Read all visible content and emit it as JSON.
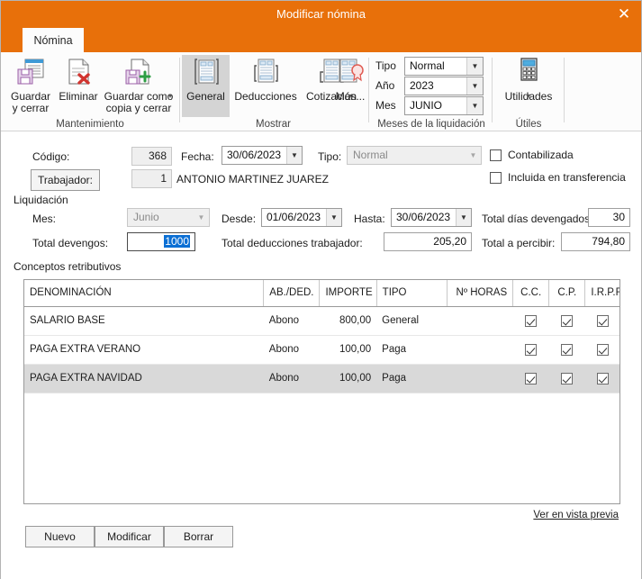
{
  "window": {
    "title": "Modificar nómina",
    "close_label": "✕",
    "accent_color": "#E8700A"
  },
  "ribbon": {
    "tab_label": "Nómina",
    "groups": [
      {
        "name": "Mantenimiento",
        "label": "Mantenimiento",
        "buttons": [
          {
            "name": "guardar-y-cerrar",
            "label": "Guardar\ny cerrar",
            "icon": "save-close-icon"
          },
          {
            "name": "eliminar",
            "label": "Eliminar",
            "icon": "delete-document-icon"
          },
          {
            "name": "guardar-como-copia-y-cerrar",
            "label": "Guardar como\ncopia y cerrar",
            "icon": "save-copy-icon",
            "has_dropdown": true
          }
        ]
      },
      {
        "name": "Mostrar",
        "label": "Mostrar",
        "buttons": [
          {
            "name": "general",
            "label": "General",
            "icon": "document-general-icon",
            "selected": true
          },
          {
            "name": "deducciones",
            "label": "Deducciones",
            "icon": "document-deductions-icon"
          },
          {
            "name": "cotizacion",
            "label": "Cotización",
            "icon": "document-contribution-icon"
          },
          {
            "name": "mas",
            "label": "Más...",
            "icon": "document-seal-icon",
            "has_dropdown": true
          }
        ]
      },
      {
        "name": "Meses de la liquidación",
        "label": "Meses de la liquidación",
        "fields": [
          {
            "name": "tipo",
            "label": "Tipo",
            "value": "Normal"
          },
          {
            "name": "ano",
            "label": "Año",
            "value": "2023"
          },
          {
            "name": "mes",
            "label": "Mes",
            "value": "JUNIO"
          }
        ]
      },
      {
        "name": "Útiles",
        "label": "Útiles",
        "buttons": [
          {
            "name": "utilidades",
            "label": "Utilidades",
            "icon": "calculator-icon",
            "has_dropdown": true
          }
        ]
      }
    ]
  },
  "form": {
    "codigo_label": "Código:",
    "codigo_value": "368",
    "fecha_label": "Fecha:",
    "fecha_value": "30/06/2023",
    "tipo_label": "Tipo:",
    "tipo_value": "Normal",
    "trabajador_button": "Trabajador:",
    "trabajador_code": "1",
    "trabajador_name": "ANTONIO MARTINEZ JUAREZ",
    "contabilizada_label": "Contabilizada",
    "incluida_label": "Incluida en transferencia",
    "liquidacion_label": "Liquidación",
    "mes_label": "Mes:",
    "mes_value": "Junio",
    "desde_label": "Desde:",
    "desde_value": "01/06/2023",
    "hasta_label": "Hasta:",
    "hasta_value": "30/06/2023",
    "total_dias_label": "Total días devengados:",
    "total_dias_value": "30",
    "total_devengos_label": "Total devengos:",
    "total_devengos_value": "1000",
    "total_deducciones_label": "Total deducciones trabajador:",
    "total_deducciones_value": "205,20",
    "total_percibir_label": "Total a percibir:",
    "total_percibir_value": "794,80",
    "conceptos_label": "Conceptos retributivos"
  },
  "grid": {
    "columns": [
      "DENOMINACIÓN",
      "AB./DED.",
      "IMPORTE",
      "TIPO",
      "Nº HORAS",
      "C.C.",
      "C.P.",
      "I.R.P.F."
    ],
    "rows": [
      {
        "denominacion": "SALARIO BASE",
        "abded": "Abono",
        "importe": "800,00",
        "tipo": "General",
        "horas": "",
        "cc": true,
        "cp": true,
        "irpf": true,
        "selected": false
      },
      {
        "denominacion": "PAGA EXTRA VERANO",
        "abded": "Abono",
        "importe": "100,00",
        "tipo": "Paga",
        "horas": "",
        "cc": true,
        "cp": true,
        "irpf": true,
        "selected": false
      },
      {
        "denominacion": "PAGA EXTRA NAVIDAD",
        "abded": "Abono",
        "importe": "100,00",
        "tipo": "Paga",
        "horas": "",
        "cc": true,
        "cp": true,
        "irpf": true,
        "selected": true
      }
    ]
  },
  "footer": {
    "nuevo_label": "Nuevo",
    "modificar_label": "Modificar",
    "borrar_label": "Borrar",
    "vista_previa_label": "Ver en vista previa"
  }
}
